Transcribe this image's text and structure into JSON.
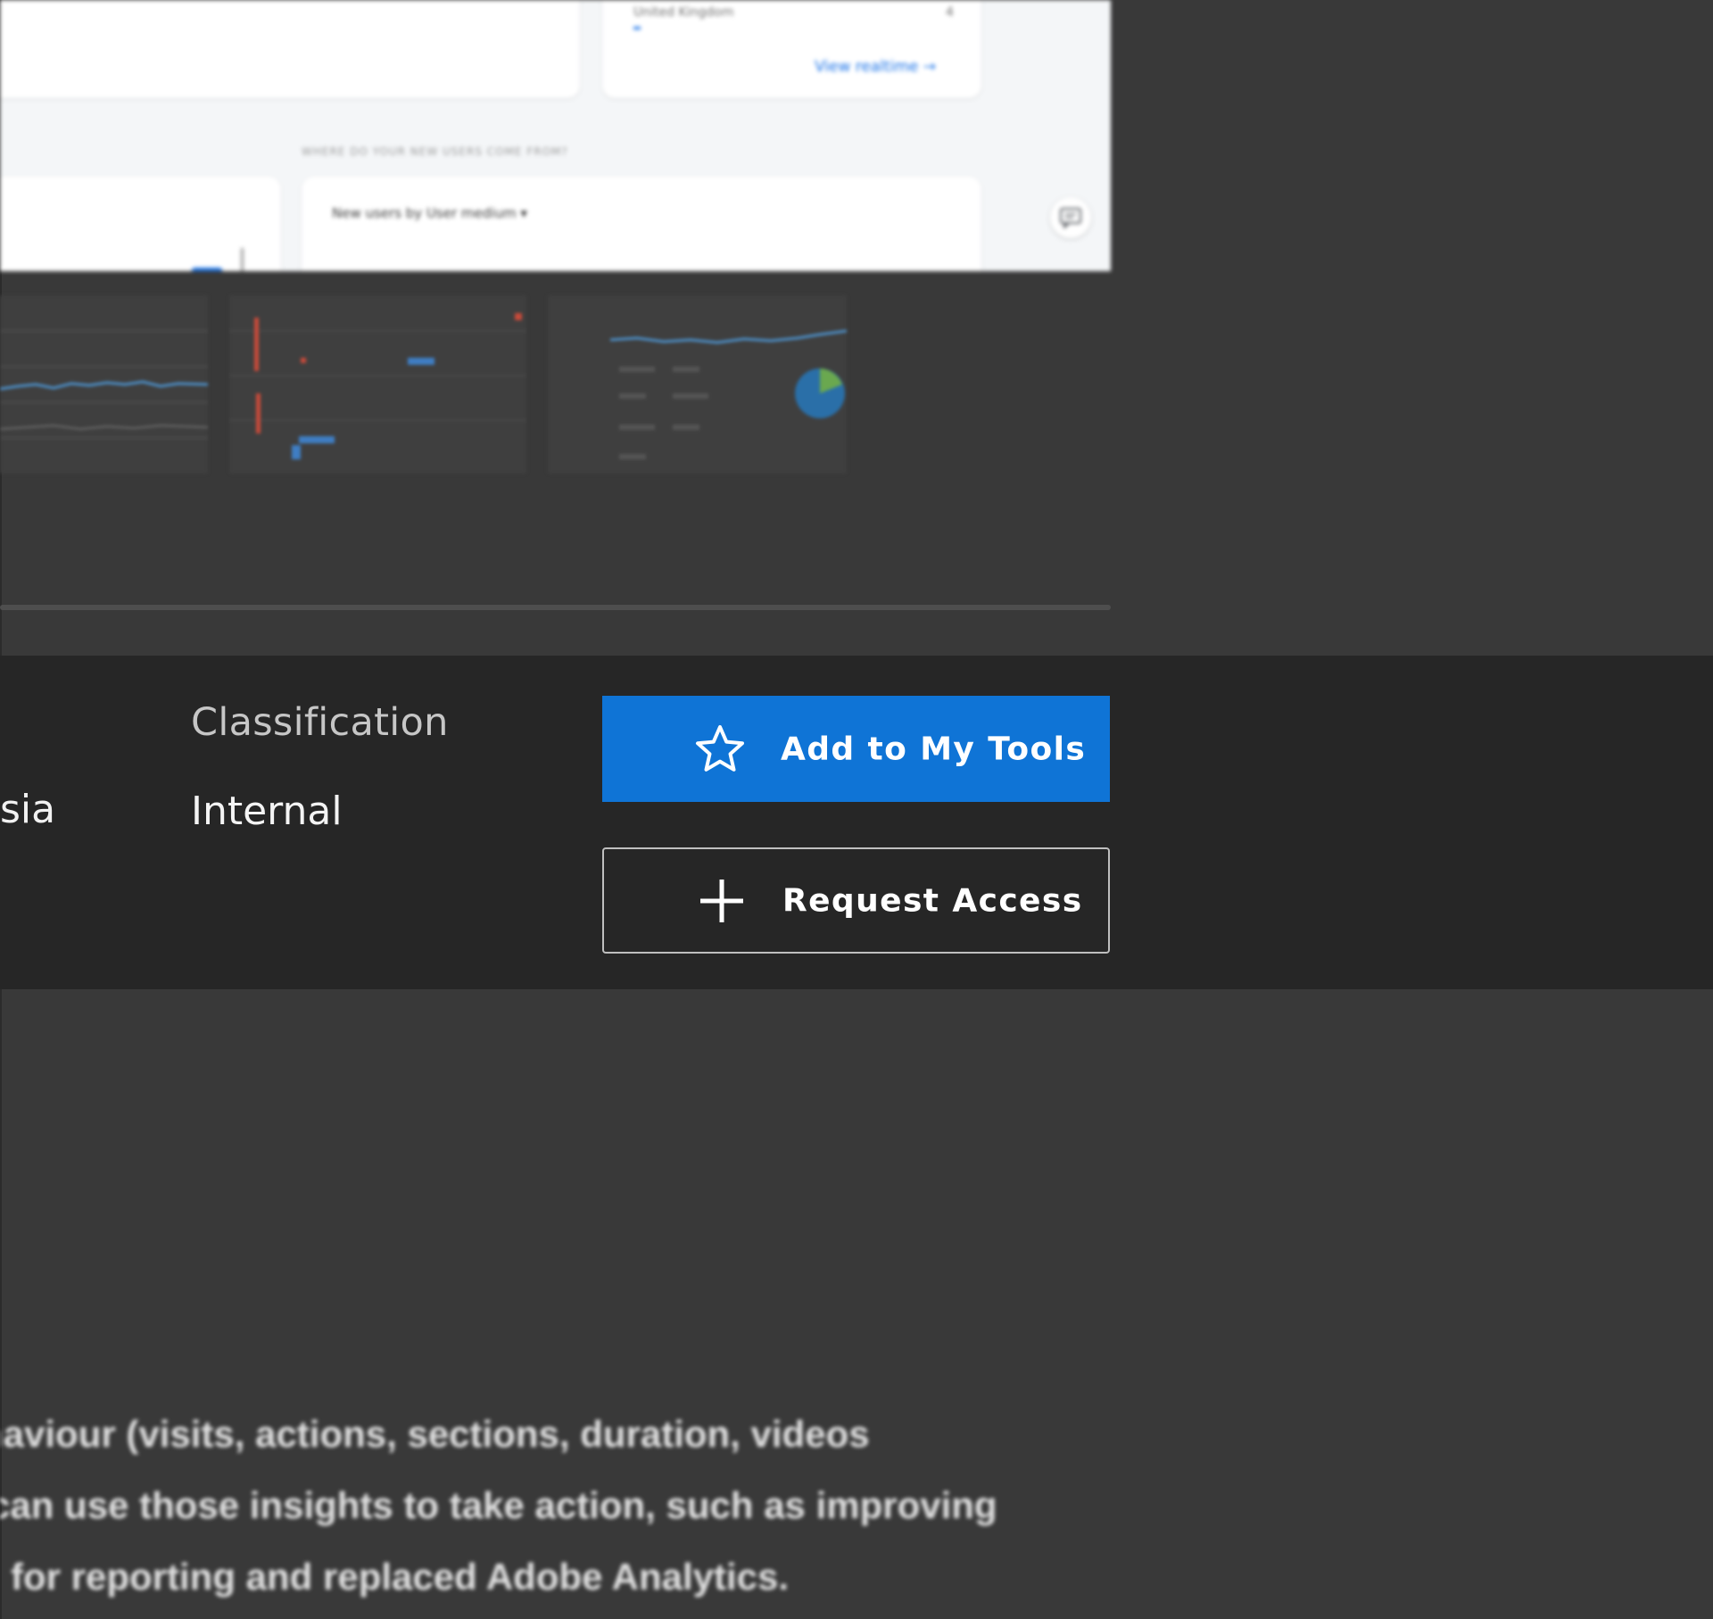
{
  "preview": {
    "country_row": "United Kingdom",
    "country_count": "4",
    "view_realtime_link": "View realtime →",
    "section_heading": "WHERE DO YOUR NEW USERS COME FROM?",
    "card_title": "New users by User medium ▾"
  },
  "details": {
    "region_value_fragment": "sia",
    "classification_label": "Classification",
    "classification_value": "Internal"
  },
  "actions": {
    "add_to_my_tools_label": "Add to My Tools",
    "request_access_label": "Request Access"
  },
  "description": {
    "lines": [
      "haviour (visits, actions, sections, duration, videos",
      "can use those insights to take action, such as improving",
      "for reporting and replaced Adobe Analytics."
    ]
  },
  "colors": {
    "page_background": "#393939",
    "info_band_background": "#262626",
    "primary_button": "#0f74d6",
    "secondary_button_border": "#bfbfbf"
  },
  "icons": {
    "add_to_my_tools": "star-outline-icon",
    "request_access": "plus-icon",
    "feedback": "chat-feedback-icon"
  }
}
